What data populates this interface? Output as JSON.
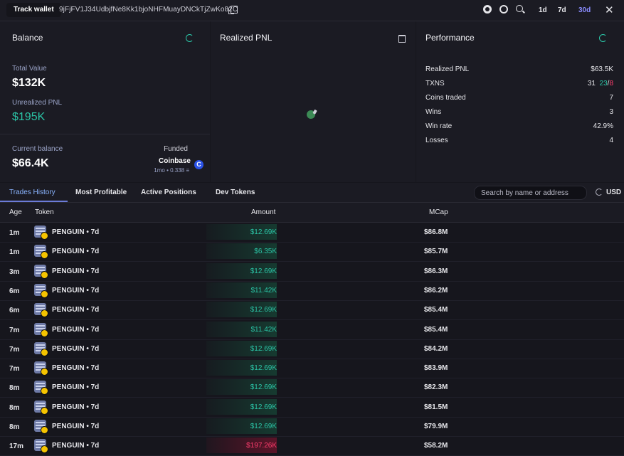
{
  "topbar": {
    "track_label": "Track wallet",
    "address": "9jFjFV1J34UdbjfNe8Kk1bjoNHFMuayDNCkTjZwKo82C",
    "timeframes": [
      "1d",
      "7d",
      "30d"
    ],
    "active_timeframe": "30d"
  },
  "balance": {
    "title": "Balance",
    "total_value_label": "Total Value",
    "total_value": "$132K",
    "unrealized_label": "Unrealized PNL",
    "unrealized_value": "$195K",
    "current_label": "Current balance",
    "current_value": "$66.4K",
    "funded_label": "Funded",
    "funded_source": "Coinbase",
    "funded_meta": "1mo • 0.338 ≡"
  },
  "realized": {
    "title": "Realized PNL"
  },
  "performance": {
    "title": "Performance",
    "rows": [
      {
        "label": "Realized PNL",
        "value": "$63.5K"
      },
      {
        "label": "TXNS",
        "value": "31",
        "buys": "23",
        "sep": "/",
        "sells": "8"
      },
      {
        "label": "Coins traded",
        "value": "7"
      },
      {
        "label": "Wins",
        "value": "3"
      },
      {
        "label": "Win rate",
        "value": "42.9%"
      },
      {
        "label": "Losses",
        "value": "4"
      }
    ]
  },
  "tabs": [
    "Trades History",
    "Most Profitable",
    "Active Positions",
    "Dev Tokens"
  ],
  "search": {
    "placeholder": "Search by name or address"
  },
  "currency": "USD",
  "table": {
    "headers": {
      "age": "Age",
      "token": "Token",
      "amount": "Amount",
      "mcap": "MCap"
    },
    "rows": [
      {
        "age": "1m",
        "token": "PENGUIN • 7d",
        "amount": "$12.69K",
        "mcap": "$86.8M",
        "side": "buy"
      },
      {
        "age": "1m",
        "token": "PENGUIN • 7d",
        "amount": "$6.35K",
        "mcap": "$85.7M",
        "side": "buy"
      },
      {
        "age": "3m",
        "token": "PENGUIN • 7d",
        "amount": "$12.69K",
        "mcap": "$86.3M",
        "side": "buy"
      },
      {
        "age": "6m",
        "token": "PENGUIN • 7d",
        "amount": "$11.42K",
        "mcap": "$86.2M",
        "side": "buy"
      },
      {
        "age": "6m",
        "token": "PENGUIN • 7d",
        "amount": "$12.69K",
        "mcap": "$85.4M",
        "side": "buy"
      },
      {
        "age": "7m",
        "token": "PENGUIN • 7d",
        "amount": "$11.42K",
        "mcap": "$85.4M",
        "side": "buy"
      },
      {
        "age": "7m",
        "token": "PENGUIN • 7d",
        "amount": "$12.69K",
        "mcap": "$84.2M",
        "side": "buy"
      },
      {
        "age": "7m",
        "token": "PENGUIN • 7d",
        "amount": "$12.69K",
        "mcap": "$83.9M",
        "side": "buy"
      },
      {
        "age": "8m",
        "token": "PENGUIN • 7d",
        "amount": "$12.69K",
        "mcap": "$82.3M",
        "side": "buy"
      },
      {
        "age": "8m",
        "token": "PENGUIN • 7d",
        "amount": "$12.69K",
        "mcap": "$81.5M",
        "side": "buy"
      },
      {
        "age": "8m",
        "token": "PENGUIN • 7d",
        "amount": "$12.69K",
        "mcap": "$79.9M",
        "side": "buy"
      },
      {
        "age": "17m",
        "token": "PENGUIN • 7d",
        "amount": "$197.26K",
        "mcap": "$58.2M",
        "side": "sell"
      }
    ]
  },
  "colors": {
    "accent_green": "#2bc4a6",
    "accent_red": "#ff3d6e",
    "accent_blue": "#8a8cff"
  }
}
